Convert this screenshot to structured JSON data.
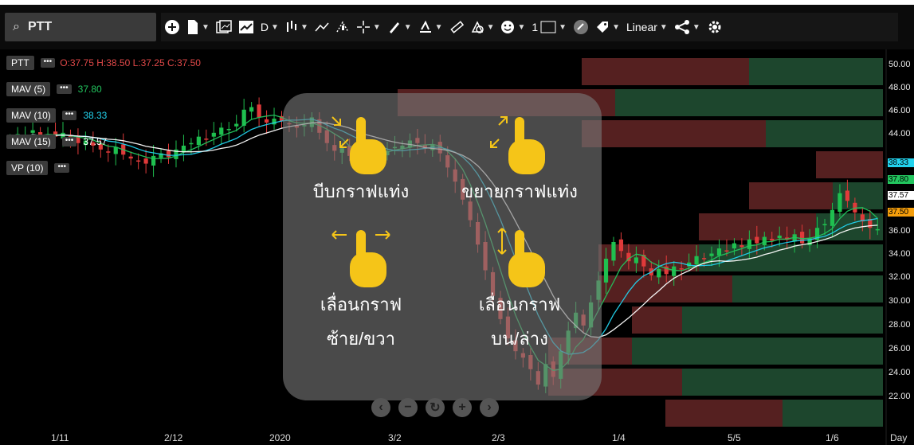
{
  "search": {
    "icon": "search-icon",
    "value": "PTT"
  },
  "toolbar": {
    "interval_label": "D",
    "scale_label": "Linear",
    "line_width_label": "1",
    "items": [
      "add-icon",
      "file-icon",
      "compare-icon",
      "chart-type-icon",
      "interval",
      "bar-type-icon",
      "trend-line-icon",
      "studies-icon",
      "crosshair-icon",
      "pencil-icon",
      "drawing-tools-icon",
      "ruler-icon",
      "shapes-icon",
      "emoji-icon",
      "line-width",
      "link-icon",
      "tag-icon",
      "scale",
      "share-icon",
      "settings-icon"
    ]
  },
  "legend": {
    "symbol": "PTT",
    "ohlc": "O:37.75 H:38.50 L:37.25 C:37.50",
    "mav5_label": "MAV (5)",
    "mav5_value": "37.80",
    "mav10_label": "MAV (10)",
    "mav10_value": "38.33",
    "mav15_label": "MAV (15)",
    "mav15_value": "37.57",
    "vp_label": "VP (10)"
  },
  "colors": {
    "up": "#1fbf4f",
    "down": "#e03a3a",
    "mav5": "#22c55e",
    "mav10": "#22d3ee",
    "mav15": "#ffffff",
    "vp_up": "#1f4a2f",
    "vp_down": "#5a2222",
    "vp_neutral": "#3c3c3c",
    "gesture_hand": "#f5c518"
  },
  "overlay": {
    "pinch_label": "บีบกราฟแท่ง",
    "spread_label": "ขยายกราฟแท่ง",
    "horizontal_label_1": "เลื่อนกราฟ",
    "horizontal_label_2": "ซ้าย/ขวา",
    "vertical_label_1": "เลื่อนกราฟ",
    "vertical_label_2": "บน/ล่าง"
  },
  "nav_buttons": [
    "scroll-left-icon",
    "zoom-out-icon",
    "reset-icon",
    "zoom-in-icon",
    "scroll-right-icon"
  ],
  "y_axis": [
    "50.00",
    "48.00",
    "46.00",
    "44.00",
    "36.00",
    "34.00",
    "32.00",
    "30.00",
    "28.00",
    "26.00",
    "24.00",
    "22.00"
  ],
  "y_tags": {
    "mav10": "38.33",
    "mav5": "37.80",
    "mav15": "37.57",
    "close": "37.50"
  },
  "x_axis": [
    "1/11",
    "2/12",
    "2020",
    "3/2",
    "2/3",
    "1/4",
    "5/5",
    "1/6"
  ],
  "x_unit": "Day",
  "chart_data": {
    "type": "candlestick",
    "ylim": [
      22,
      51
    ],
    "close_series": [
      44.5,
      44.9,
      44.8,
      45.2,
      44.6,
      44.9,
      44.7,
      45.0,
      44.6,
      44.2,
      44.4,
      44.0,
      43.7,
      43.5,
      43.9,
      43.3,
      43.0,
      42.8,
      42.6,
      43.2,
      43.4,
      43.1,
      43.7,
      44.0,
      44.2,
      44.7,
      44.5,
      45.0,
      45.4,
      45.3,
      45.7,
      46.8,
      47.0,
      46.2,
      45.8,
      46.1,
      45.9,
      45.7,
      45.4,
      45.6,
      46.2,
      45.0,
      44.2,
      43.6,
      43.8,
      43.2,
      43.1,
      43.5,
      43.9,
      43.4,
      43.6,
      43.9,
      44.0,
      44.4,
      44.2,
      43.8,
      44.1,
      43.4,
      42.3,
      41.2,
      39.8,
      38.2,
      36.3,
      34.3,
      32.3,
      30.5,
      29.0,
      28.0,
      27.5,
      26.6,
      25.4,
      27.0,
      26.0,
      28.0,
      29.6,
      31.0,
      30.0,
      31.8,
      33.5,
      35.2,
      36.5,
      35.8,
      35.0,
      35.3,
      34.6,
      33.9,
      34.4,
      34.0,
      34.6,
      34.4,
      34.9,
      35.4,
      35.2,
      35.6,
      36.0,
      35.8,
      36.4,
      36.1,
      36.7,
      36.4,
      36.9,
      36.6,
      37.0,
      36.7,
      37.1,
      36.4,
      36.8,
      37.6,
      37.9,
      39.0,
      40.3,
      39.7,
      38.8,
      38.1,
      37.6,
      37.5
    ],
    "vp_up_widths": [
      0.4,
      0.8,
      0.35,
      0.0,
      0.15,
      0.2,
      0.55,
      0.45,
      0.6,
      0.75,
      0.6,
      0.3
    ],
    "vp_down_widths": [
      0.5,
      0.65,
      0.55,
      0.2,
      0.25,
      0.35,
      0.3,
      0.4,
      0.15,
      0.25,
      0.4,
      0.35
    ]
  }
}
